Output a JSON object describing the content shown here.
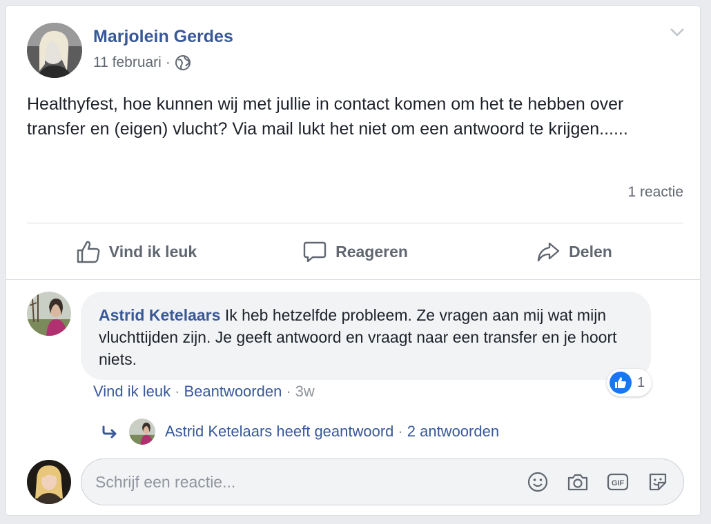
{
  "post": {
    "author": "Marjolein Gerdes",
    "date": "11 februari",
    "separator": "·",
    "text": "Healthyfest, hoe kunnen wij met jullie in contact komen om het te hebben over transfer en (eigen) vlucht? Via mail lukt het niet om een antwoord te krijgen......",
    "reaction_count": "1 reactie"
  },
  "actions": {
    "like_label": "Vind ik leuk",
    "comment_label": "Reageren",
    "share_label": "Delen"
  },
  "comment": {
    "author": "Astrid Ketelaars",
    "text": "Ik heb hetzelfde probleem. Ze vragen aan mij wat mijn vluchttijden zijn. Je geeft antwoord en vraagt naar een transfer en je hoort niets.",
    "likes": "1",
    "like_action": "Vind ik leuk",
    "reply_action": "Beantwoorden",
    "time": "3w",
    "separator": "·"
  },
  "replies": {
    "summary": "Astrid Ketelaars heeft geantwoord",
    "count": "2 antwoorden",
    "separator": "·"
  },
  "composer": {
    "placeholder": "Schrijf een reactie..."
  },
  "colors": {
    "link": "#385898",
    "like_blue": "#1877f2",
    "muted": "#606770"
  }
}
